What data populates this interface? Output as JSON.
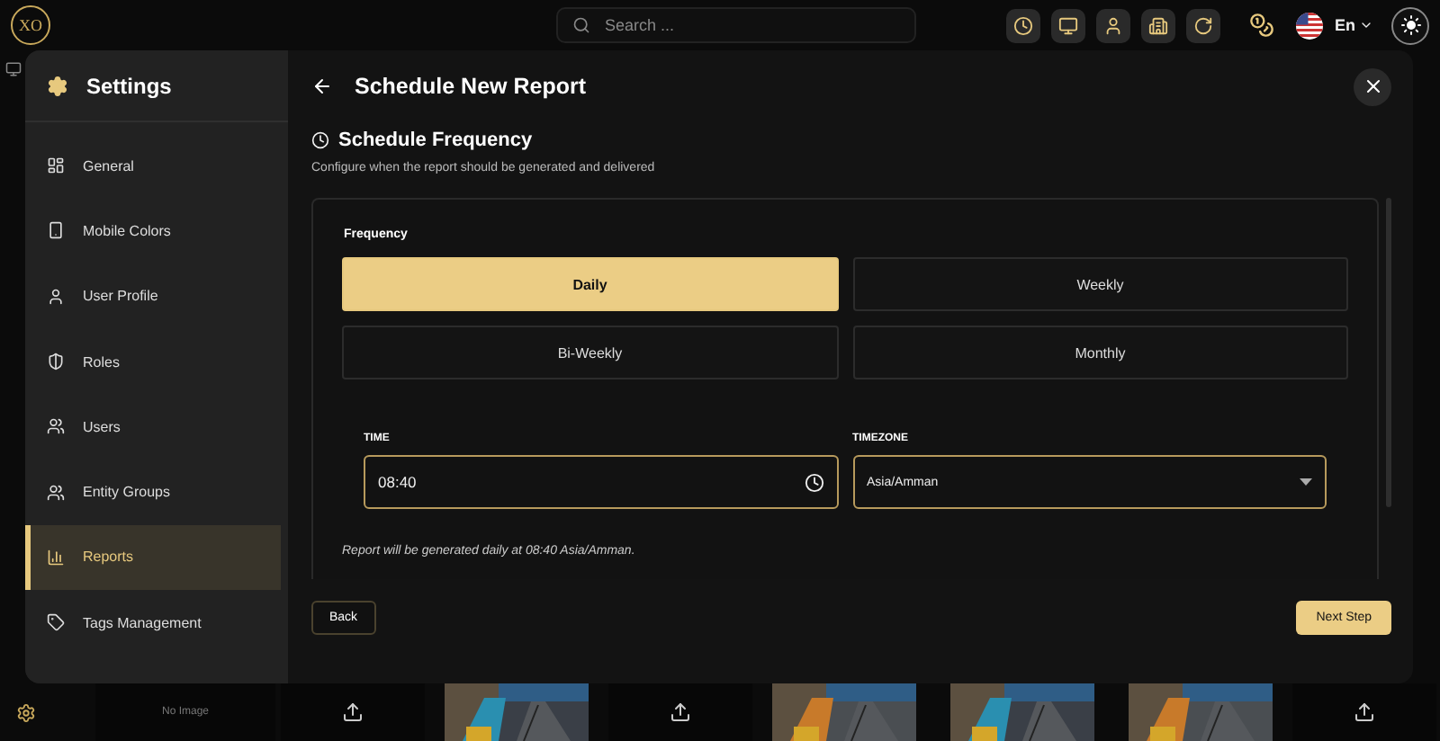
{
  "topbar": {
    "logo": "XO",
    "search": {
      "placeholder": "Search ..."
    },
    "language": "En"
  },
  "settings": {
    "title": "Settings",
    "items": [
      {
        "label": "General",
        "selected": false
      },
      {
        "label": "Mobile Colors",
        "selected": false
      },
      {
        "label": "User Profile",
        "selected": false
      },
      {
        "label": "Roles",
        "selected": false
      },
      {
        "label": "Users",
        "selected": false
      },
      {
        "label": "Entity Groups",
        "selected": false
      },
      {
        "label": "Reports",
        "selected": true
      },
      {
        "label": "Tags Management",
        "selected": false
      }
    ]
  },
  "dialog": {
    "title": "Schedule New Report",
    "section": {
      "title": "Schedule Frequency",
      "description": "Configure when the report should be generated and delivered"
    },
    "frequency": {
      "label": "Frequency",
      "options": [
        {
          "label": "Daily",
          "selected": true
        },
        {
          "label": "Weekly",
          "selected": false
        },
        {
          "label": "Bi-Weekly",
          "selected": false
        },
        {
          "label": "Monthly",
          "selected": false
        }
      ]
    },
    "time": {
      "label": "TIME",
      "value": "08:40"
    },
    "timezone": {
      "label": "TIMEZONE",
      "value": "Asia/Amman"
    },
    "summary": "Report will be generated daily at 08:40 Asia/Amman.",
    "buttons": {
      "back": "Back",
      "next": "Next Step"
    }
  },
  "gallery": [
    {
      "kind": "empty",
      "text": "No Image"
    },
    {
      "kind": "upload"
    },
    {
      "kind": "picture"
    },
    {
      "kind": "upload"
    },
    {
      "kind": "picture"
    },
    {
      "kind": "picture"
    },
    {
      "kind": "picture"
    },
    {
      "kind": "upload"
    }
  ]
}
